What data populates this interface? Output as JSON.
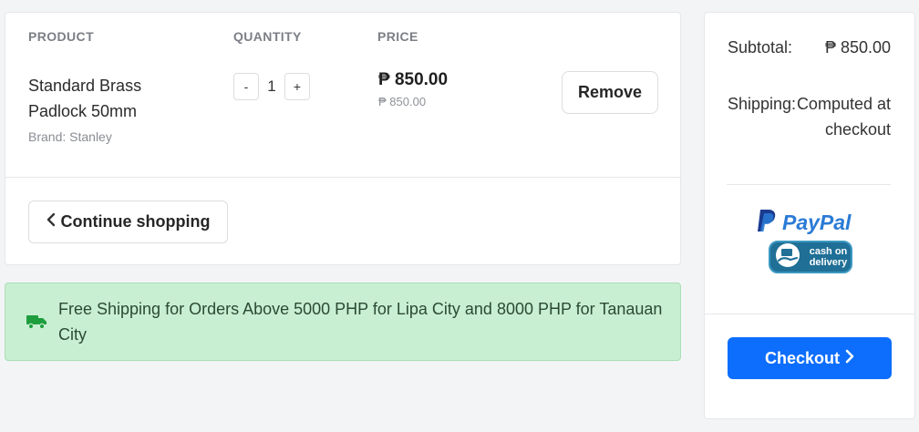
{
  "cart": {
    "headers": {
      "product": "PRODUCT",
      "quantity": "QUANTITY",
      "price": "PRICE"
    },
    "item": {
      "name": "Standard Brass Padlock 50mm",
      "brand": "Brand: Stanley",
      "qty_minus": "-",
      "qty_value": "1",
      "qty_plus": "+",
      "price": "₱ 850.00",
      "price_sub": "₱ 850.00",
      "remove_label": "Remove"
    },
    "continue_label": "Continue shopping"
  },
  "notice": {
    "text": "Free Shipping for Orders Above 5000 PHP for Lipa City and 8000 PHP for Tanauan City",
    "icon": "truck-icon"
  },
  "summary": {
    "subtotal_label": "Subtotal:",
    "subtotal_value": "₱ 850.00",
    "shipping_label": "Shipping:",
    "shipping_value": "Computed at checkout",
    "paypal_label": "PayPal",
    "cod_label": "cash on delivery",
    "checkout_label": "Checkout"
  },
  "colors": {
    "accent": "#0d6efd",
    "notice_bg": "#c9efd2",
    "notice_icon": "#1e9e3e",
    "paypal_blue": "#2a7bd6",
    "paypal_dark": "#1a3b8f"
  }
}
